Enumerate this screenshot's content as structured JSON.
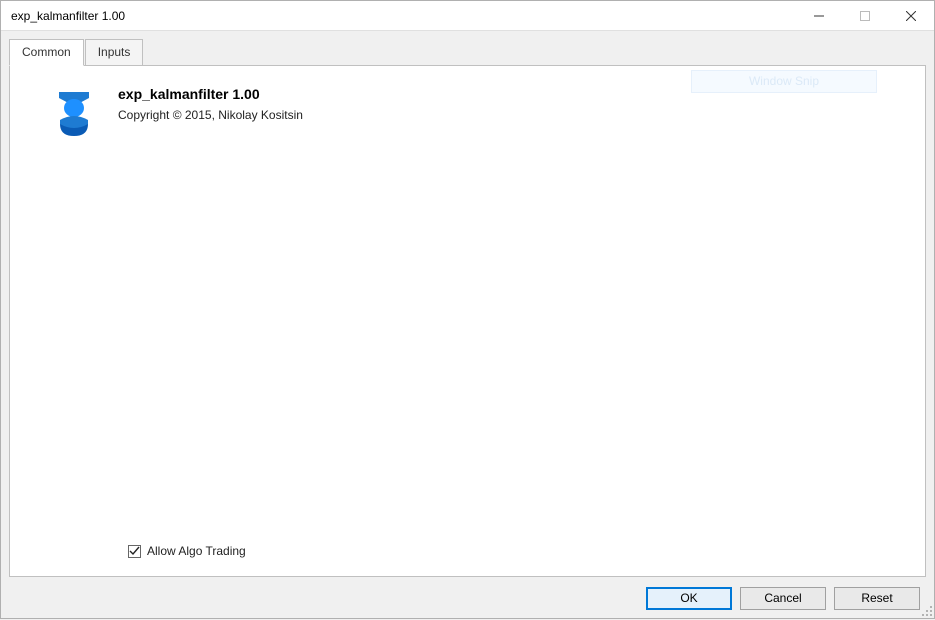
{
  "window": {
    "title": "exp_kalmanfilter 1.00"
  },
  "tabs": {
    "common": "Common",
    "inputs": "Inputs"
  },
  "ghost_button": "Window Snip",
  "expert": {
    "title": "exp_kalmanfilter 1.00",
    "copyright": "Copyright © 2015, Nikolay Kositsin"
  },
  "checkbox": {
    "allow_algo_label": "Allow Algo Trading",
    "checked": true
  },
  "buttons": {
    "ok": "OK",
    "cancel": "Cancel",
    "reset": "Reset"
  }
}
